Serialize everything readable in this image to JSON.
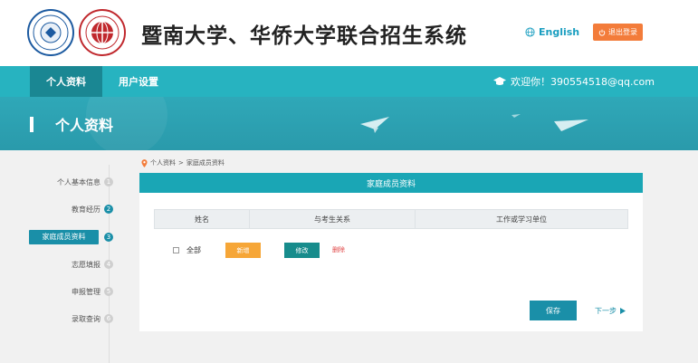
{
  "header": {
    "title": "暨南大学、华侨大学联合招生系统",
    "lang_label": "English",
    "logout_label": "退出登录"
  },
  "nav": {
    "tabs": [
      {
        "label": "个人资料",
        "active": true
      },
      {
        "label": "用户设置",
        "active": false
      }
    ],
    "welcome": "欢迎你！390554518@qq.com"
  },
  "banner": {
    "title": "个人资料"
  },
  "sidebar": {
    "items": [
      {
        "label": "个人基本信息",
        "num": "1",
        "done": false
      },
      {
        "label": "教育经历",
        "num": "2",
        "done": true
      },
      {
        "label": "家庭成员资料",
        "num": "3",
        "done": true,
        "active": true
      },
      {
        "label": "志愿填报",
        "num": "4",
        "done": false
      },
      {
        "label": "申报管理",
        "num": "5",
        "done": false
      },
      {
        "label": "录取查询",
        "num": "6",
        "done": false
      }
    ]
  },
  "breadcrumb": {
    "part1": "个人资料",
    "sep": ">",
    "part2": "家庭成员资料"
  },
  "panel": {
    "title": "家庭成员资料",
    "columns": [
      "姓名",
      "与考生关系",
      "工作或学习单位"
    ],
    "select_all": "全部",
    "add": "新增",
    "edit": "修改",
    "delete": "删除",
    "save": "保存",
    "next": "下一步"
  },
  "colors": {
    "teal": "#27b3c0",
    "teal_dark": "#1a8fa8",
    "orange": "#f37c3a",
    "add_orange": "#f6a637",
    "edit_green": "#178c8c",
    "delete_red": "#e04545"
  }
}
